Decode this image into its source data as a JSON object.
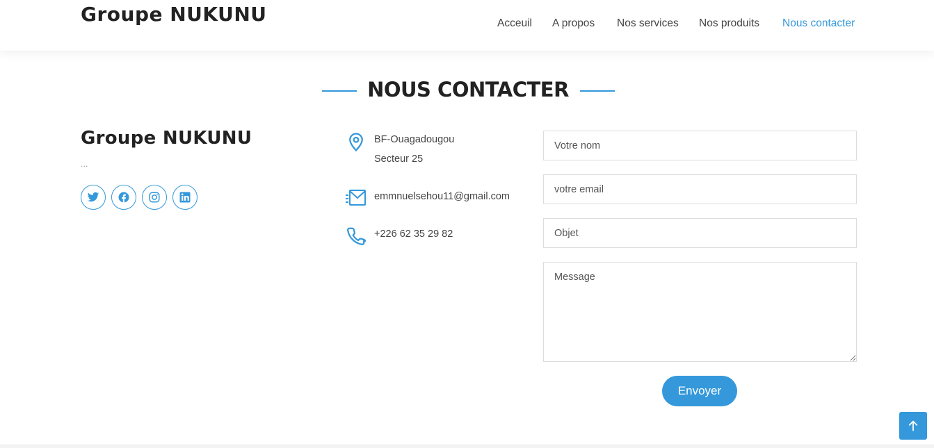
{
  "header": {
    "logo": "Groupe NUKUNU",
    "nav": [
      {
        "label": "Acceuil",
        "active": false
      },
      {
        "label": "A propos",
        "active": false
      },
      {
        "label": "Nos services",
        "active": false
      },
      {
        "label": "Nos produits",
        "active": false
      },
      {
        "label": "Nous contacter",
        "active": true
      }
    ]
  },
  "section": {
    "title": "NOUS CONTACTER"
  },
  "about": {
    "name": "Groupe NUKUNU",
    "description": "...",
    "social": [
      {
        "icon": "twitter-icon"
      },
      {
        "icon": "facebook-icon"
      },
      {
        "icon": "instagram-icon"
      },
      {
        "icon": "linkedin-icon"
      }
    ]
  },
  "contact_info": {
    "address_line1": "BF-Ouagadougou",
    "address_line2": "Secteur 25",
    "email": "emmnuelsehou11@gmail.com",
    "phone": "+226 62 35 29 82"
  },
  "form": {
    "name_placeholder": "Votre nom",
    "email_placeholder": "votre email",
    "subject_placeholder": "Objet",
    "message_placeholder": "Message",
    "submit_label": "Envoyer"
  },
  "colors": {
    "accent": "#3498db",
    "heading": "#222222",
    "text": "#444444"
  }
}
